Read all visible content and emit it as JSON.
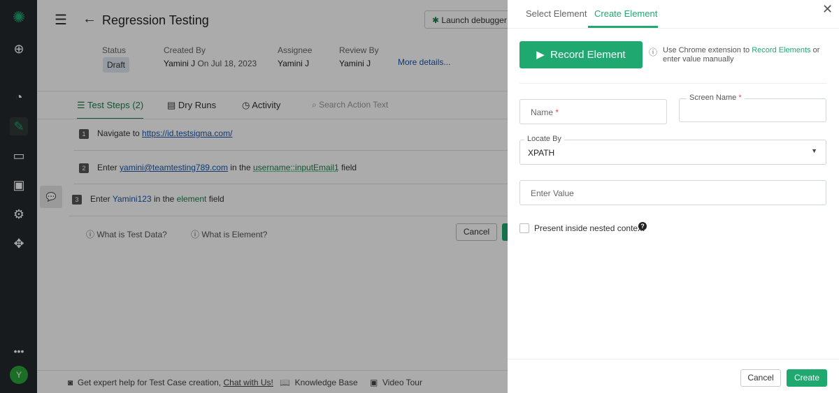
{
  "sidebar": {
    "items": [
      "logo",
      "add",
      "dashboard",
      "test-cases",
      "test-plans",
      "devices",
      "settings",
      "add-ons",
      "more"
    ],
    "avatar": "Y"
  },
  "header": {
    "title": "Regression Testing",
    "launch_debugger": "Launch debugger"
  },
  "meta": {
    "status_label": "Status",
    "status": "Draft",
    "created_label": "Created By",
    "created_by": "Yamini J",
    "created_on": "On Jul 18, 2023",
    "assignee_label": "Assignee",
    "assignee": "Yamini J",
    "review_label": "Review By",
    "reviewer": "Yamini J",
    "more": "More details..."
  },
  "tabs": {
    "steps": "Test Steps (2)",
    "dry_runs": "Dry Runs",
    "activity": "Activity",
    "search_placeholder": "Search Action Text"
  },
  "steps": [
    {
      "n": "1",
      "a": "Navigate to",
      "url": "https://id.testsigma.com/"
    },
    {
      "n": "2",
      "a": "Enter",
      "data": "yamini@teamtesting789.com",
      "mid": "in the",
      "element": "username::inputEmail1",
      "end": "field"
    },
    {
      "n": "3",
      "a": "Enter",
      "data": "Yamini123",
      "mid": "in the",
      "element": "element",
      "end": "field"
    }
  ],
  "help": {
    "test_data": "What is Test Data?",
    "element": "What is Element?",
    "cancel": "Cancel"
  },
  "footer": {
    "expert": "Get expert help for Test Case creation,",
    "chat": "Chat with Us!",
    "kb": "Knowledge Base",
    "tour": "Video Tour"
  },
  "panel": {
    "tab_select": "Select Element",
    "tab_create": "Create Element",
    "record": "Record Element",
    "info_pre": "Use Chrome extension to",
    "info_link": "Record Elements",
    "info_post": "or enter value manually",
    "name_label": "Name",
    "screen_label": "Screen Name",
    "required": "*",
    "locate_label": "Locate By",
    "locate_value": "XPATH",
    "value_placeholder": "Enter Value",
    "nested": "Present inside nested context",
    "cancel": "Cancel",
    "create": "Create"
  },
  "colors": {
    "accent": "#1fa971",
    "sidebar": "#25292e"
  }
}
